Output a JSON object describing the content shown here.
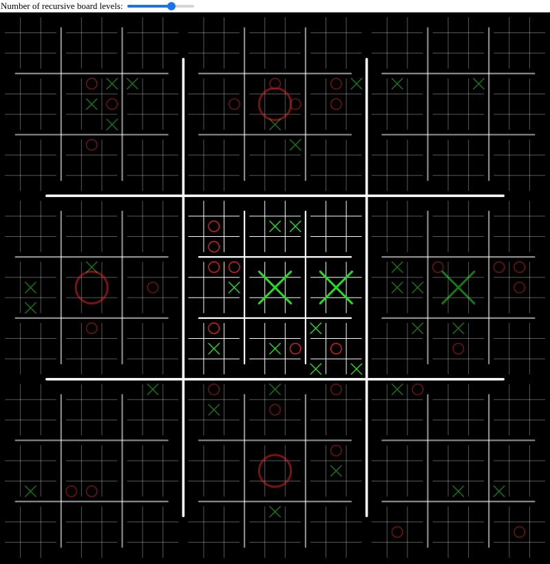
{
  "controls": {
    "levels_label": "Number of recursive board levels:",
    "levels_value": 3,
    "levels_min": 1,
    "levels_max": 4,
    "levels_fill_fraction": 0.66
  },
  "colors": {
    "background": "#000000",
    "x_mark": "#22e022",
    "o_mark": "#e02020",
    "grid": "#ffffff",
    "accent": "#1a73e8"
  },
  "board": {
    "active_center_board": [
      4
    ],
    "won_cells": [
      {
        "path": [
          1,
          4
        ],
        "mark": "O"
      },
      {
        "path": [
          3,
          4
        ],
        "mark": "O"
      },
      {
        "path": [
          7,
          4
        ],
        "mark": "O"
      },
      {
        "path": [
          4,
          4
        ],
        "mark": "X"
      },
      {
        "path": [
          4,
          5
        ],
        "mark": "X"
      },
      {
        "path": [
          5,
          4
        ],
        "mark": "X"
      }
    ],
    "marks": [
      {
        "path": [
          0,
          4,
          1
        ],
        "mark": "O"
      },
      {
        "path": [
          0,
          4,
          2
        ],
        "mark": "X"
      },
      {
        "path": [
          0,
          5,
          0
        ],
        "mark": "X"
      },
      {
        "path": [
          0,
          4,
          4
        ],
        "mark": "X"
      },
      {
        "path": [
          0,
          4,
          5
        ],
        "mark": "O"
      },
      {
        "path": [
          0,
          4,
          8
        ],
        "mark": "X"
      },
      {
        "path": [
          0,
          7,
          1
        ],
        "mark": "O"
      },
      {
        "path": [
          1,
          4,
          1
        ],
        "mark": "O"
      },
      {
        "path": [
          1,
          5,
          1
        ],
        "mark": "O"
      },
      {
        "path": [
          1,
          5,
          2
        ],
        "mark": "X"
      },
      {
        "path": [
          1,
          3,
          5
        ],
        "mark": "O"
      },
      {
        "path": [
          1,
          4,
          5
        ],
        "mark": "O"
      },
      {
        "path": [
          1,
          5,
          4
        ],
        "mark": "O"
      },
      {
        "path": [
          1,
          4,
          7
        ],
        "mark": "X"
      },
      {
        "path": [
          1,
          7,
          2
        ],
        "mark": "X"
      },
      {
        "path": [
          2,
          3,
          1
        ],
        "mark": "X"
      },
      {
        "path": [
          2,
          4,
          2
        ],
        "mark": "X"
      },
      {
        "path": [
          3,
          4,
          1
        ],
        "mark": "X"
      },
      {
        "path": [
          3,
          3,
          4
        ],
        "mark": "X"
      },
      {
        "path": [
          3,
          5,
          4
        ],
        "mark": "O"
      },
      {
        "path": [
          3,
          3,
          7
        ],
        "mark": "X"
      },
      {
        "path": [
          3,
          7,
          1
        ],
        "mark": "O"
      },
      {
        "path": [
          4,
          0,
          4
        ],
        "mark": "O"
      },
      {
        "path": [
          4,
          0,
          7
        ],
        "mark": "O"
      },
      {
        "path": [
          4,
          1,
          4
        ],
        "mark": "X"
      },
      {
        "path": [
          4,
          1,
          5
        ],
        "mark": "X"
      },
      {
        "path": [
          4,
          3,
          2
        ],
        "mark": "O"
      },
      {
        "path": [
          4,
          3,
          1
        ],
        "mark": "O"
      },
      {
        "path": [
          4,
          3,
          5
        ],
        "mark": "X"
      },
      {
        "path": [
          4,
          6,
          1
        ],
        "mark": "O"
      },
      {
        "path": [
          4,
          6,
          4
        ],
        "mark": "X"
      },
      {
        "path": [
          4,
          7,
          4
        ],
        "mark": "X"
      },
      {
        "path": [
          4,
          7,
          5
        ],
        "mark": "O"
      },
      {
        "path": [
          4,
          8,
          0
        ],
        "mark": "X"
      },
      {
        "path": [
          4,
          8,
          4
        ],
        "mark": "O"
      },
      {
        "path": [
          4,
          8,
          6
        ],
        "mark": "X"
      },
      {
        "path": [
          4,
          8,
          8
        ],
        "mark": "X"
      },
      {
        "path": [
          5,
          3,
          1
        ],
        "mark": "X"
      },
      {
        "path": [
          5,
          4,
          0
        ],
        "mark": "O"
      },
      {
        "path": [
          5,
          5,
          0
        ],
        "mark": "O"
      },
      {
        "path": [
          5,
          5,
          1
        ],
        "mark": "O"
      },
      {
        "path": [
          5,
          3,
          4
        ],
        "mark": "X"
      },
      {
        "path": [
          5,
          3,
          5
        ],
        "mark": "X"
      },
      {
        "path": [
          5,
          5,
          4
        ],
        "mark": "O"
      },
      {
        "path": [
          5,
          6,
          2
        ],
        "mark": "X"
      },
      {
        "path": [
          5,
          7,
          1
        ],
        "mark": "X"
      },
      {
        "path": [
          5,
          7,
          4
        ],
        "mark": "O"
      },
      {
        "path": [
          6,
          2,
          1
        ],
        "mark": "X"
      },
      {
        "path": [
          6,
          3,
          7
        ],
        "mark": "X"
      },
      {
        "path": [
          6,
          4,
          6
        ],
        "mark": "O"
      },
      {
        "path": [
          6,
          4,
          7
        ],
        "mark": "O"
      },
      {
        "path": [
          7,
          0,
          1
        ],
        "mark": "O"
      },
      {
        "path": [
          7,
          0,
          4
        ],
        "mark": "X"
      },
      {
        "path": [
          7,
          1,
          1
        ],
        "mark": "X"
      },
      {
        "path": [
          7,
          1,
          4
        ],
        "mark": "O"
      },
      {
        "path": [
          7,
          2,
          1
        ],
        "mark": "O"
      },
      {
        "path": [
          7,
          5,
          1
        ],
        "mark": "O"
      },
      {
        "path": [
          7,
          5,
          4
        ],
        "mark": "X"
      },
      {
        "path": [
          7,
          7,
          1
        ],
        "mark": "X"
      },
      {
        "path": [
          8,
          0,
          1
        ],
        "mark": "X"
      },
      {
        "path": [
          8,
          0,
          2
        ],
        "mark": "O"
      },
      {
        "path": [
          8,
          4,
          7
        ],
        "mark": "X"
      },
      {
        "path": [
          8,
          5,
          6
        ],
        "mark": "X"
      },
      {
        "path": [
          8,
          6,
          4
        ],
        "mark": "O"
      },
      {
        "path": [
          8,
          8,
          4
        ],
        "mark": "O"
      }
    ]
  }
}
